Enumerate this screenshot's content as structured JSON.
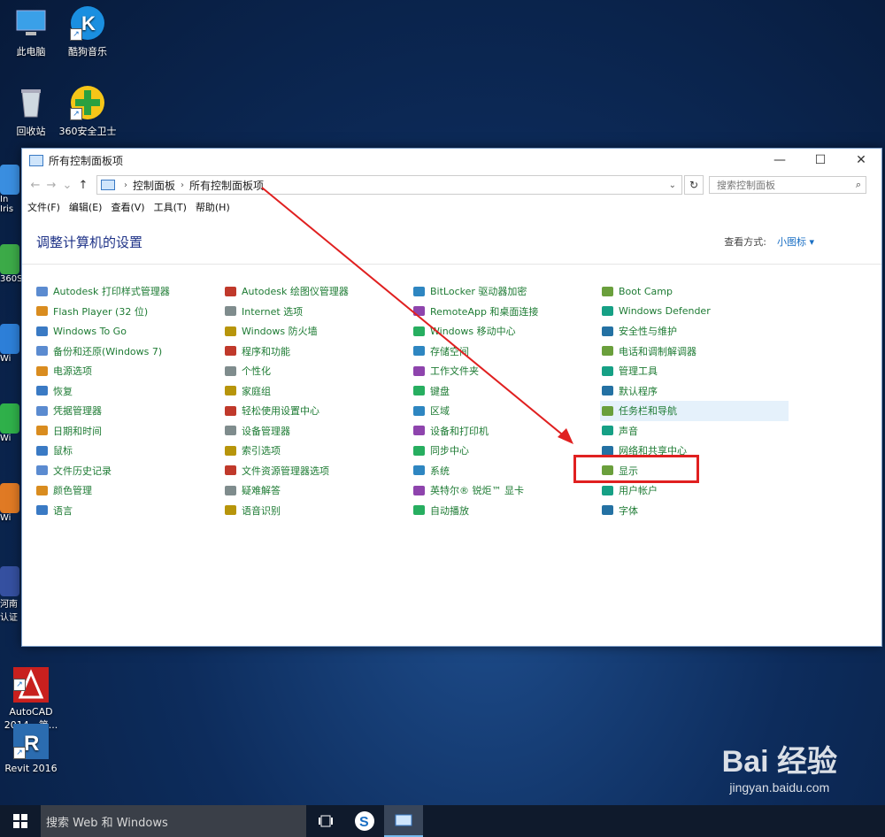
{
  "desktop": {
    "icons": [
      {
        "label": "此电脑",
        "icon": "computer-icon"
      },
      {
        "label": "酷狗音乐",
        "icon": "kugou-icon"
      },
      {
        "label": "回收站",
        "icon": "recycle-bin-icon"
      },
      {
        "label": "360安全卫士",
        "icon": "360-icon"
      },
      {
        "label": "AutoCAD\n2014 - 简...",
        "icon": "autocad-icon"
      },
      {
        "label": "Revit 2016",
        "icon": "revit-icon"
      }
    ],
    "edge_labels": [
      "In",
      "Iris",
      "360S",
      "Wi",
      "Wi",
      "Wi",
      "河南",
      "认证"
    ]
  },
  "window": {
    "title": "所有控制面板项",
    "min": "—",
    "max": "☐",
    "close": "✕",
    "nav": {
      "back": "←",
      "forward": "→",
      "recent": "⌄",
      "up": "↑"
    },
    "breadcrumb": [
      "控制面板",
      "所有控制面板项"
    ],
    "search_placeholder": "搜索控制面板",
    "menu": [
      "文件(F)",
      "编辑(E)",
      "查看(V)",
      "工具(T)",
      "帮助(H)"
    ],
    "page_title": "调整计算机的设置",
    "view_by_label": "查看方式:",
    "view_by_value": "小图标 ▾",
    "items": [
      [
        "Autodesk 打印样式管理器",
        "Autodesk 绘图仪管理器",
        "BitLocker 驱动器加密",
        "Boot Camp"
      ],
      [
        "Flash Player (32 位)",
        "Internet 选项",
        "RemoteApp 和桌面连接",
        "Windows Defender"
      ],
      [
        "Windows To Go",
        "Windows 防火墙",
        "Windows 移动中心",
        "安全性与维护"
      ],
      [
        "备份和还原(Windows 7)",
        "程序和功能",
        "存储空间",
        "电话和调制解调器"
      ],
      [
        "电源选项",
        "个性化",
        "工作文件夹",
        "管理工具"
      ],
      [
        "恢复",
        "家庭组",
        "键盘",
        "默认程序"
      ],
      [
        "凭据管理器",
        "轻松使用设置中心",
        "区域",
        "任务栏和导航"
      ],
      [
        "日期和时间",
        "设备管理器",
        "设备和打印机",
        "声音"
      ],
      [
        "鼠标",
        "索引选项",
        "同步中心",
        "网络和共享中心"
      ],
      [
        "文件历史记录",
        "文件资源管理器选项",
        "系统",
        "显示"
      ],
      [
        "颜色管理",
        "疑难解答",
        "英特尔® 锐炬™ 显卡",
        "用户帐户"
      ],
      [
        "语言",
        "语音识别",
        "自动播放",
        "字体"
      ]
    ],
    "highlighted_item": "任务栏和导航",
    "target_item": "显示"
  },
  "colors": {
    "link": "#1e7b34",
    "title": "#1e3287",
    "annotation": "#e02020"
  },
  "taskbar": {
    "search_text": "搜索 Web 和 Windows",
    "start_icon": "windows-logo-icon"
  },
  "watermark": {
    "logo": "Bai 经验",
    "url": "jingyan.baidu.com"
  }
}
